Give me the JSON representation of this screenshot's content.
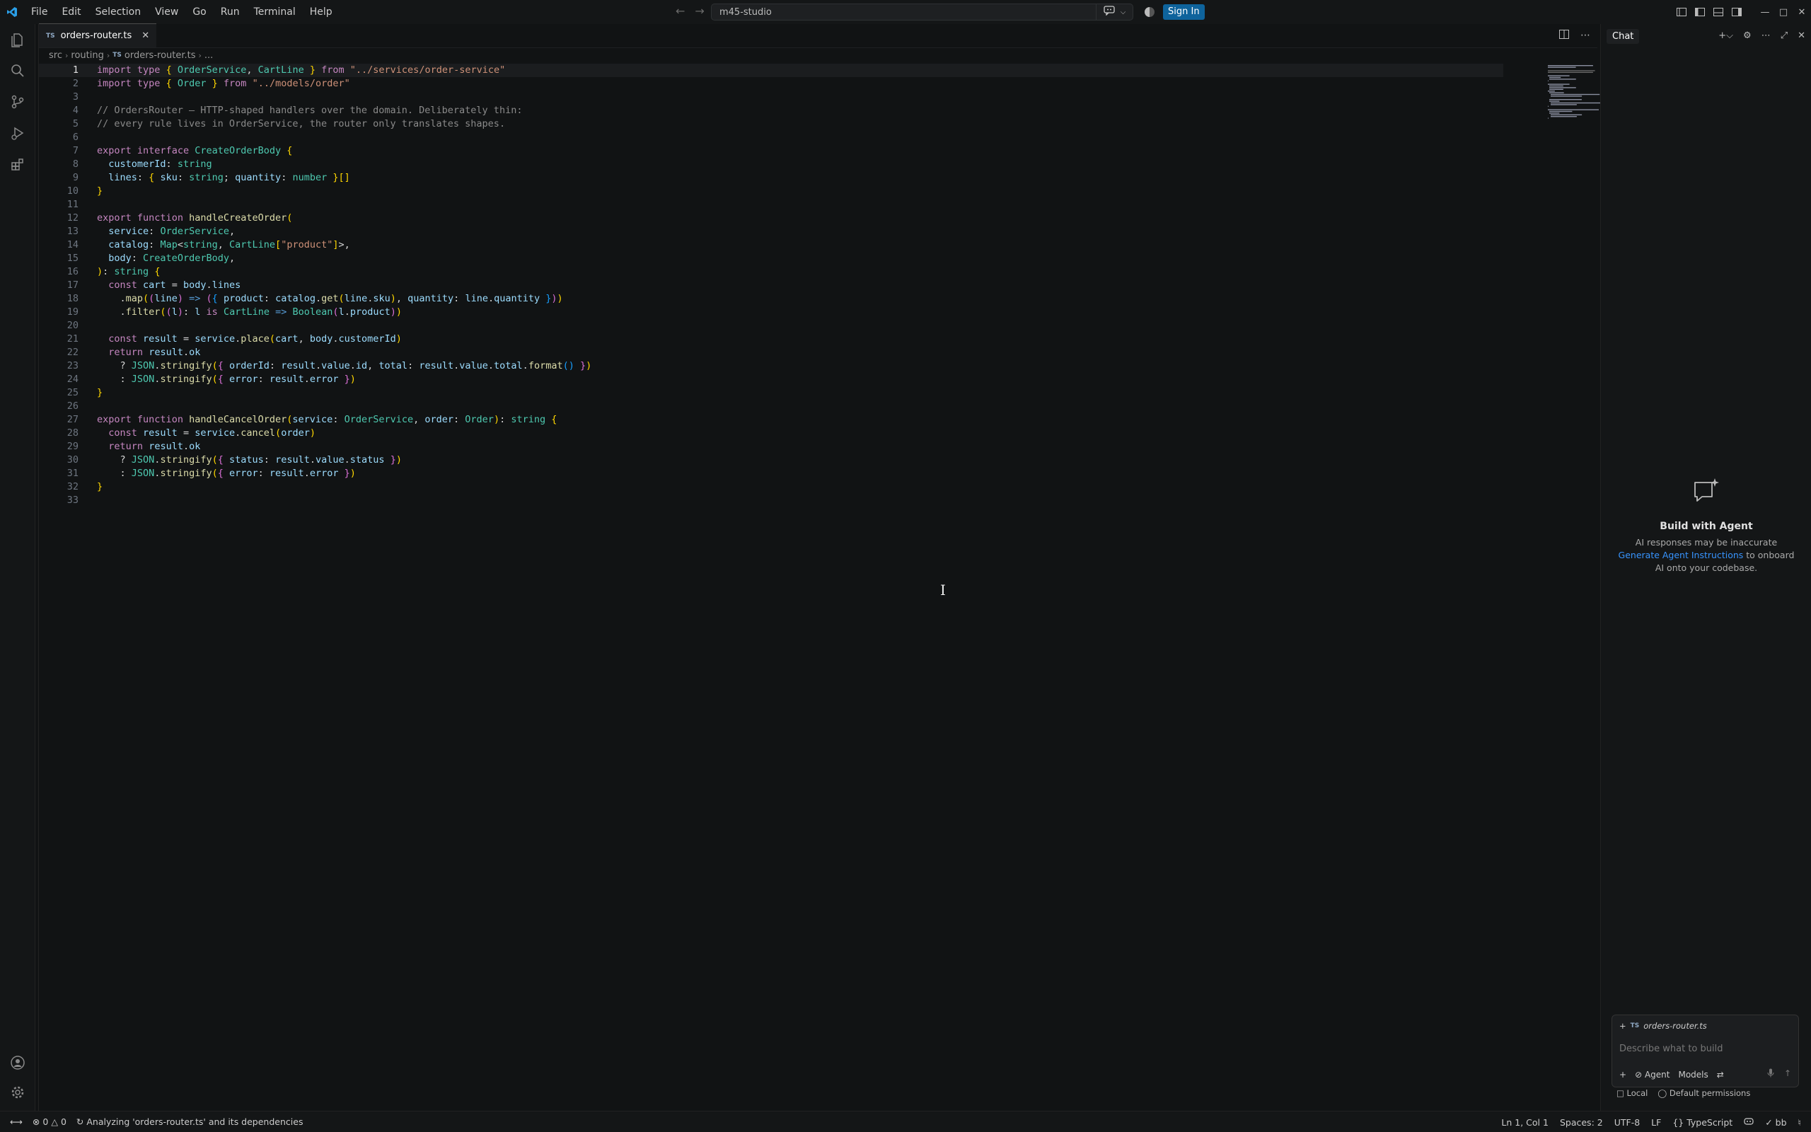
{
  "app": {
    "menu": [
      "File",
      "Edit",
      "Selection",
      "View",
      "Go",
      "Run",
      "Terminal",
      "Help"
    ],
    "command_center": "m45-studio",
    "sign_in": "Sign In"
  },
  "editor": {
    "tab_badge": "TS",
    "tab_label": "orders-router.ts",
    "breadcrumb": [
      "src",
      "routing",
      "orders-router.ts",
      "..."
    ],
    "current_line": 1
  },
  "code_lines": [
    "import type { OrderService, CartLine } from \"../services/order-service\"",
    "import type { Order } from \"../models/order\"",
    "",
    "// OrdersRouter — HTTP-shaped handlers over the domain. Deliberately thin:",
    "// every rule lives in OrderService, the router only translates shapes.",
    "",
    "export interface CreateOrderBody {",
    "  customerId: string",
    "  lines: { sku: string; quantity: number }[]",
    "}",
    "",
    "export function handleCreateOrder(",
    "  service: OrderService,",
    "  catalog: Map<string, CartLine[\"product\"]>,",
    "  body: CreateOrderBody,",
    "): string {",
    "  const cart = body.lines",
    "    .map((line) => ({ product: catalog.get(line.sku), quantity: line.quantity }))",
    "    .filter((l): l is CartLine => Boolean(l.product))",
    "",
    "  const result = service.place(cart, body.customerId)",
    "  return result.ok",
    "    ? JSON.stringify({ orderId: result.value.id, total: result.value.total.format() })",
    "    : JSON.stringify({ error: result.error })",
    "}",
    "",
    "export function handleCancelOrder(service: OrderService, order: Order): string {",
    "  const result = service.cancel(order)",
    "  return result.ok",
    "    ? JSON.stringify({ status: result.value.status })",
    "    : JSON.stringify({ error: result.error })",
    "}",
    ""
  ],
  "chat": {
    "title": "Chat",
    "welcome_title": "Build with Agent",
    "welcome_line1": "AI responses may be inaccurate",
    "welcome_link": "Generate Agent Instructions",
    "welcome_line2_rest": " to onboard AI onto your codebase.",
    "context_badge": "TS",
    "context_file": "orders-router.ts",
    "input_placeholder": "Describe what to build",
    "mode": "Agent",
    "models": "Models",
    "local": "Local",
    "permissions": "Default permissions"
  },
  "status": {
    "errors": "0",
    "warnings": "0",
    "activity": "Analyzing 'orders-router.ts' and its dependencies",
    "position": "Ln 1, Col 1",
    "spaces": "Spaces: 2",
    "encoding": "UTF-8",
    "eol": "LF",
    "language": "TypeScript",
    "account": "bb"
  },
  "colors": {
    "accent": "#0e639c",
    "link": "#3794ff",
    "background": "#111314"
  }
}
